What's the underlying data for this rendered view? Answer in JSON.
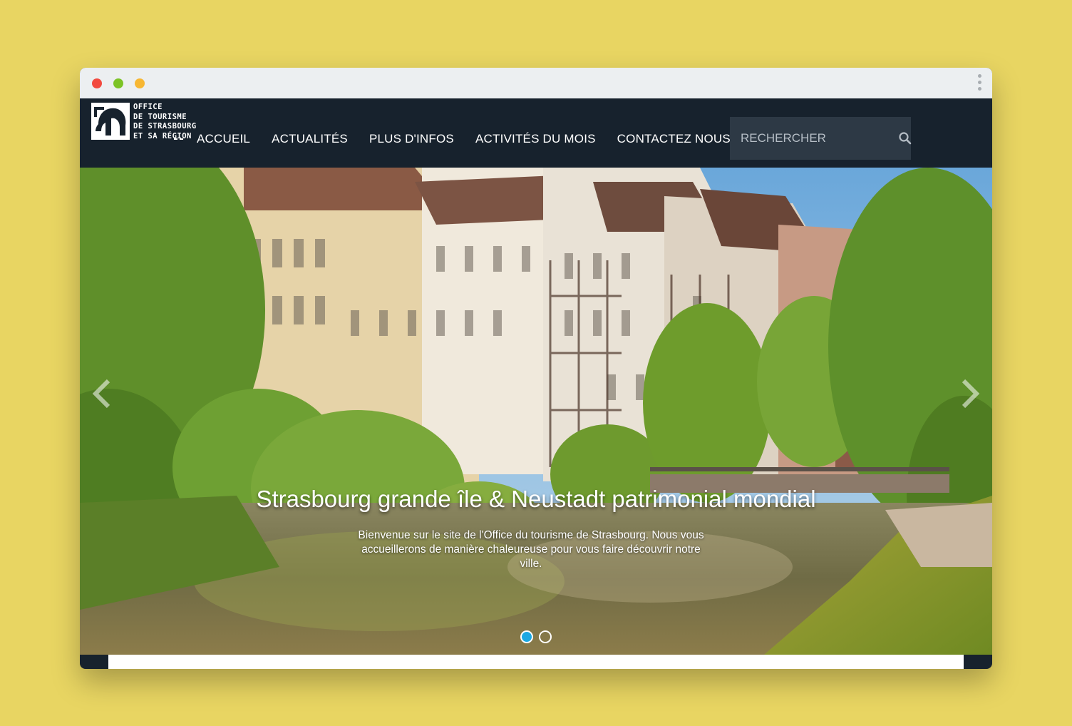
{
  "window": {
    "traffic_lights": [
      "#f24a3f",
      "#7cc326",
      "#f7b733"
    ]
  },
  "navbar": {
    "logo": {
      "lines": [
        "OFFICE",
        "DE TOURISME",
        "DE STRASBOURG",
        "ET SA RÉGION"
      ]
    },
    "items": [
      {
        "label": "ACCUEIL"
      },
      {
        "label": "ACTUALITÉS"
      },
      {
        "label": "PLUS D'INFOS"
      },
      {
        "label": "ACTIVITÉS DU MOIS"
      },
      {
        "label": "CONTACTEZ NOUS"
      }
    ],
    "search": {
      "placeholder": "RECHERCHER",
      "icon": "search-icon"
    }
  },
  "hero": {
    "title": "Strasbourg grande île & Neustadt patrimonial mondial",
    "subtitle": "Bienvenue sur le site de l'Office du tourisme de Strasbourg. Nous vous accueillerons de manière chaleureuse pour vous faire découvrir notre ville.",
    "slides": {
      "count": 2,
      "active_index": 0
    },
    "prev_icon": "chevron-left-icon",
    "next_icon": "chevron-right-icon"
  },
  "colors": {
    "page_background": "#e8d562",
    "navbar": "#17222d",
    "search_box": "#2d3945",
    "indicator_active": "#1ba8e3"
  }
}
